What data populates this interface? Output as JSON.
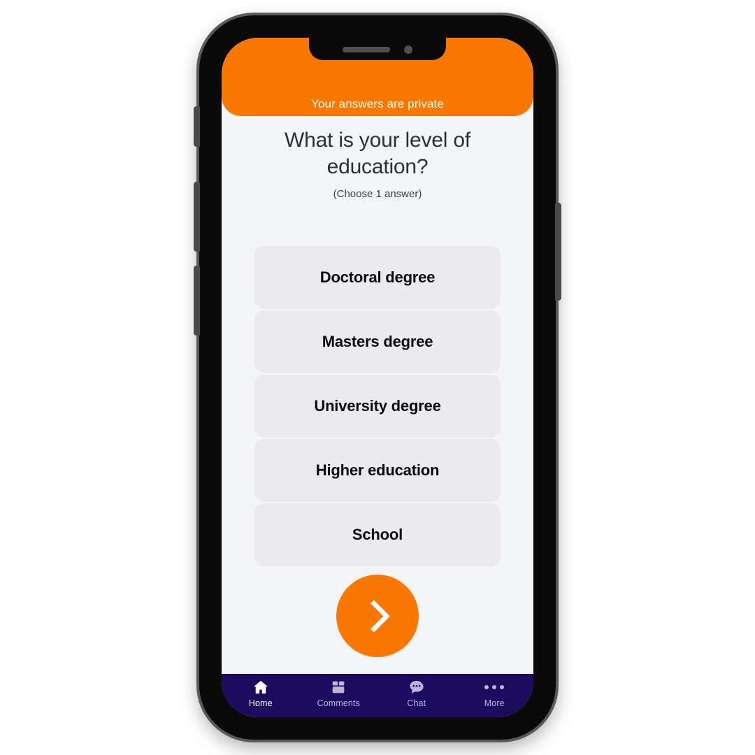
{
  "header": {
    "privacy_notice": "Your answers are private",
    "accent_color": "#fa7800"
  },
  "question": {
    "title": "What is your level of education?",
    "subtitle": "(Choose 1 answer)"
  },
  "options": [
    {
      "label": "Doctoral degree"
    },
    {
      "label": "Masters degree"
    },
    {
      "label": "University degree"
    },
    {
      "label": "Higher education"
    },
    {
      "label": "School"
    }
  ],
  "next_button": {
    "icon": "chevron-right-icon",
    "color": "#fa7800"
  },
  "bottom_nav": {
    "background_color": "#1b0a5e",
    "active_color": "#ffffff",
    "inactive_color": "#b9b6dd",
    "items": [
      {
        "label": "Home",
        "icon": "home-icon",
        "active": true
      },
      {
        "label": "Comments",
        "icon": "box-icon",
        "active": false
      },
      {
        "label": "Chat",
        "icon": "chat-icon",
        "active": false
      },
      {
        "label": "More",
        "icon": "ellipsis-icon",
        "active": false
      }
    ]
  }
}
